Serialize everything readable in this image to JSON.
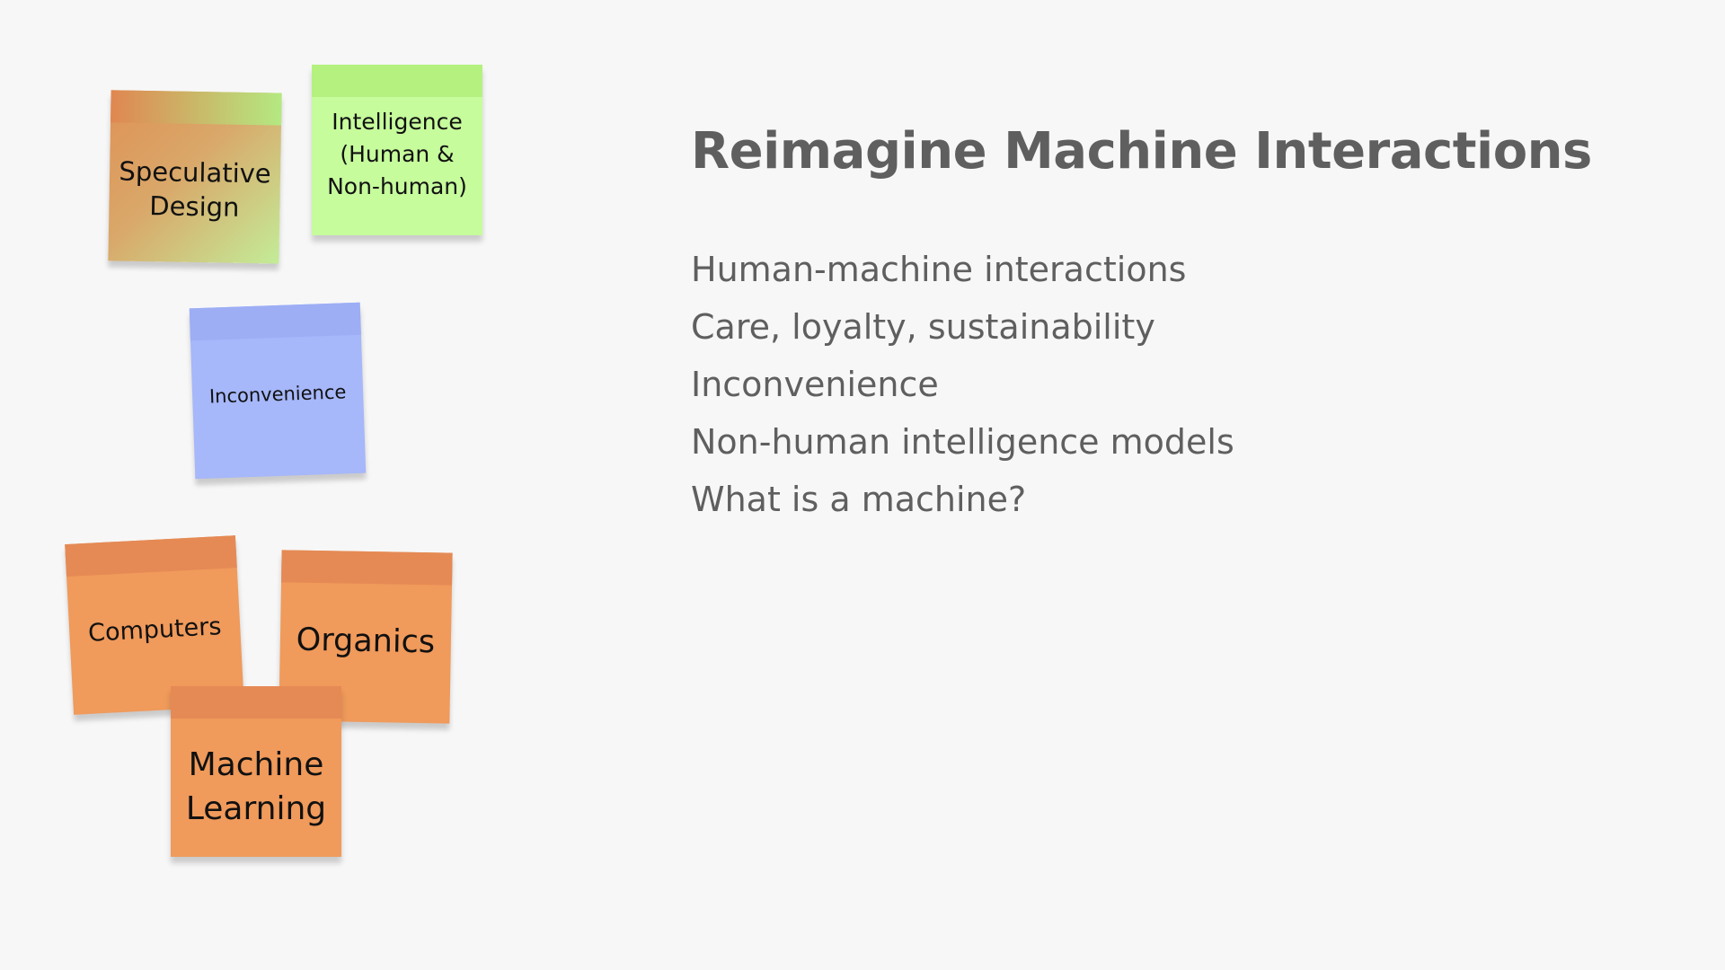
{
  "slide": {
    "title": "Reimagine Machine Interactions",
    "topics": [
      "Human-machine interactions",
      "Care, loyalty, sustainability",
      "Inconvenience",
      "Non-human intelligence models",
      "What is a machine?"
    ]
  },
  "sticky_notes": [
    {
      "id": "speculative",
      "lines": [
        "Speculative",
        "Design"
      ],
      "color": "#e09155",
      "accent": "#c3ec98"
    },
    {
      "id": "intelligence",
      "lines": [
        "Intelligence",
        "(Human &",
        "Non-human)"
      ],
      "color": "#c6fc9c"
    },
    {
      "id": "inconvenience",
      "lines": [
        "Inconvenience"
      ],
      "color": "#a6b7fa"
    },
    {
      "id": "computers",
      "lines": [
        "Computers"
      ],
      "color": "#f09a5b"
    },
    {
      "id": "organics",
      "lines": [
        "Organics"
      ],
      "color": "#f09a5b"
    },
    {
      "id": "machine-learning",
      "lines": [
        "Machine",
        "Learning"
      ],
      "color": "#f09a5b"
    }
  ]
}
